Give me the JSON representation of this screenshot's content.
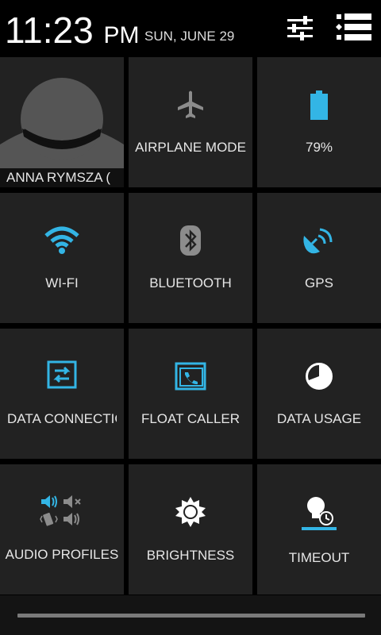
{
  "header": {
    "time": "11:23",
    "ampm": "PM",
    "date": "SUN, JUNE 29",
    "settings_icon": "sliders-icon",
    "list_icon": "notification-list-icon"
  },
  "tiles": {
    "user": {
      "label": "ANNA RYMSZA ("
    },
    "airplane": {
      "label": "AIRPLANE MODE"
    },
    "battery": {
      "label": "79%",
      "level": 0.79
    },
    "wifi": {
      "label": "WI-FI"
    },
    "bluetooth": {
      "label": "BLUETOOTH"
    },
    "gps": {
      "label": "GPS"
    },
    "data_connection": {
      "label": "DATA CONNECTIC"
    },
    "float_caller": {
      "label": "FLOAT CALLER"
    },
    "data_usage": {
      "label": "DATA USAGE"
    },
    "audio_profiles": {
      "label": "AUDIO PROFILES"
    },
    "brightness": {
      "label": "BRIGHTNESS"
    },
    "timeout": {
      "label": "TIMEOUT"
    }
  },
  "colors": {
    "accent": "#33b5e5",
    "tile_bg": "#222222",
    "inactive_icon": "#8c8c8c"
  }
}
